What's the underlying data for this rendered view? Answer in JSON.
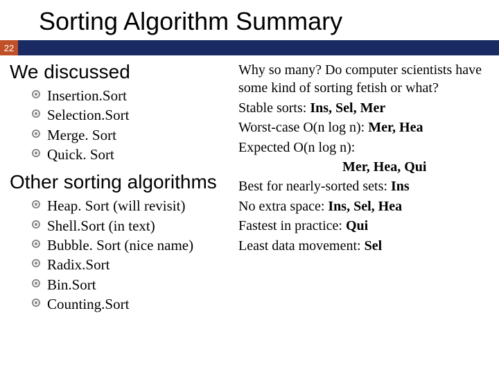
{
  "title": "Sorting Algorithm Summary",
  "page_number": "22",
  "left": {
    "section1_head": "We discussed",
    "section1_items": [
      "Insertion.Sort",
      "Selection.Sort",
      "Merge. Sort",
      "Quick. Sort"
    ],
    "section2_head": "Other sorting algorithms",
    "section2_items": [
      "Heap. Sort (will revisit)",
      "Shell.Sort (in text)",
      "Bubble. Sort (nice name)",
      "Radix.Sort",
      "Bin.Sort",
      "Counting.Sort"
    ]
  },
  "right": {
    "l1": "Why so many?  Do computer scientists have some kind of sorting fetish or what?",
    "l2a": "Stable sorts: ",
    "l2b": "Ins, Sel, Mer",
    "l3a": "Worst-case O(n log n): ",
    "l3b": "Mer, Hea",
    "l4": "Expected O(n log n):",
    "l5": "Mer, Hea, Qui",
    "l6a": "Best for nearly-sorted sets: ",
    "l6b": "Ins",
    "l7a": "No extra space: ",
    "l7b": "Ins, Sel, Hea",
    "l8a": "Fastest in practice: ",
    "l8b": "Qui",
    "l9a": "Least data movement: ",
    "l9b": "Sel"
  }
}
